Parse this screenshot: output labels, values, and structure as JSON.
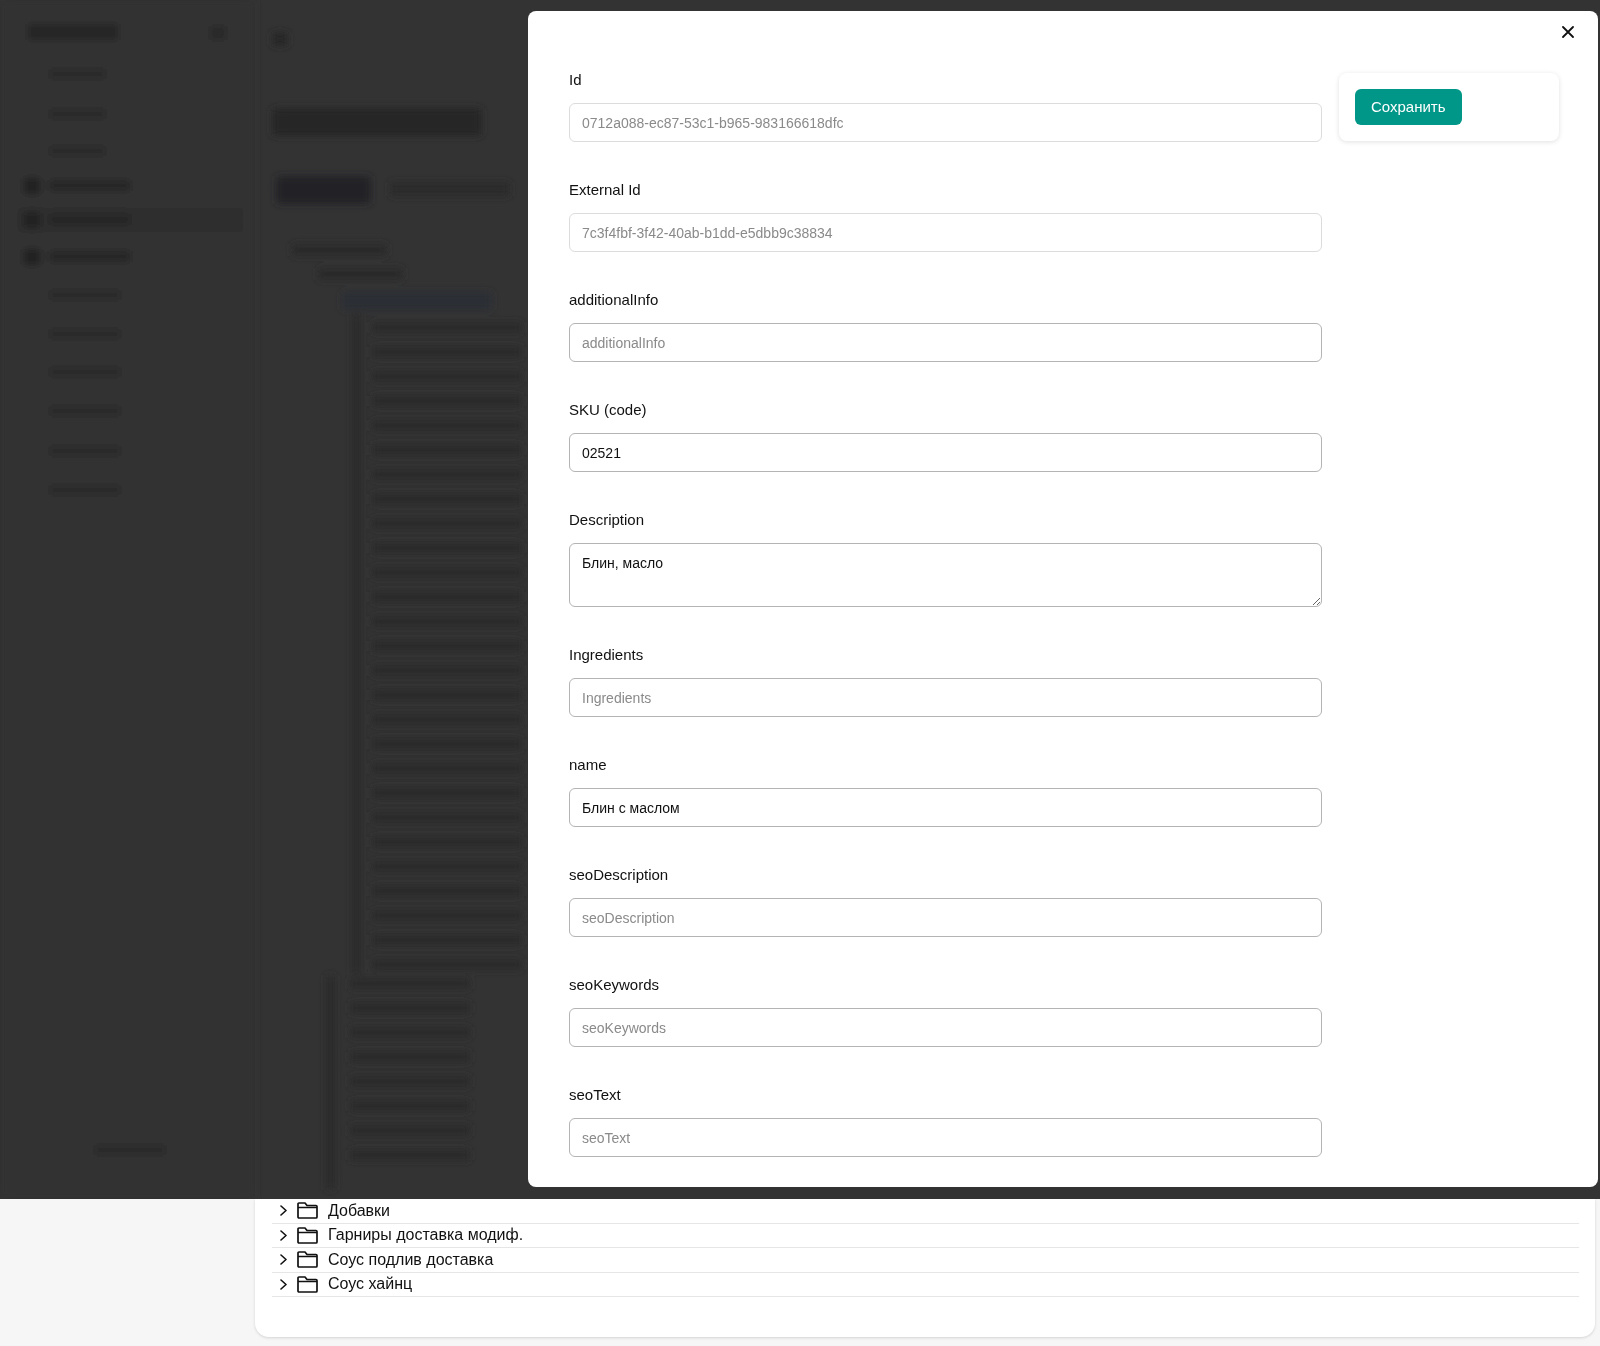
{
  "catalog_tree": {
    "items": [
      {
        "label": "Добавки",
        "expanded": false
      },
      {
        "label": "Гарниры доставка модиф.",
        "expanded": false
      },
      {
        "label": "Соус подлив доставка",
        "expanded": false
      },
      {
        "label": "Соус хайнц",
        "expanded": false
      }
    ]
  },
  "dialog": {
    "fields": [
      {
        "kind": "input",
        "label": "Id",
        "value": "0712a088-ec87-53c1-b965-983166618dfc",
        "disabled": true
      },
      {
        "kind": "input",
        "label": "External Id",
        "value": "7c3f4fbf-3f42-40ab-b1dd-e5dbb9c38834",
        "disabled": true
      },
      {
        "kind": "input",
        "label": "additionalInfo",
        "placeholder": "additionalInfo",
        "disabled": false
      },
      {
        "kind": "input",
        "label": "SKU (code)",
        "value": "02521",
        "disabled": false
      },
      {
        "kind": "textarea",
        "label": "Description",
        "value": "Блин, масло",
        "disabled": false
      },
      {
        "kind": "input",
        "label": "Ingredients",
        "placeholder": "Ingredients",
        "disabled": false
      },
      {
        "kind": "input",
        "label": "name",
        "value": "Блин с маслом",
        "disabled": false
      },
      {
        "kind": "input",
        "label": "seoDescription",
        "placeholder": "seoDescription",
        "disabled": false
      },
      {
        "kind": "input",
        "label": "seoKeywords",
        "placeholder": "seoKeywords",
        "disabled": false
      },
      {
        "kind": "input",
        "label": "seoText",
        "placeholder": "seoText",
        "disabled": false
      }
    ],
    "save_button": "Сохранить"
  }
}
